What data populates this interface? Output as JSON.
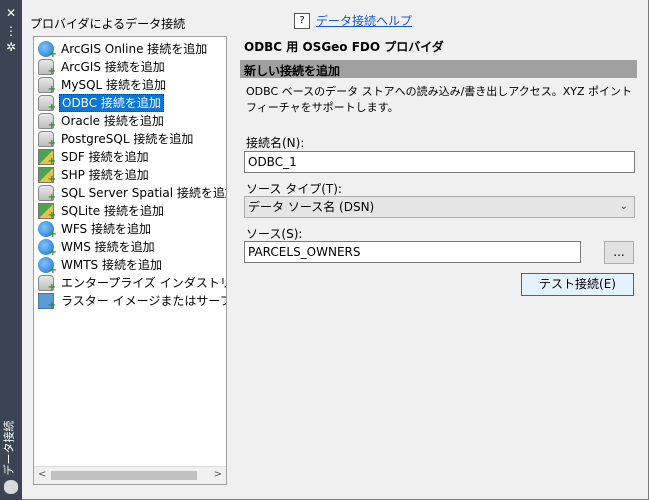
{
  "sidebar": {
    "close_icon": "✕",
    "menu_icon": "⋮",
    "gear_icon": "✲",
    "vertical_title": "データ接続"
  },
  "provider_label": "プロバイダによるデータ接続",
  "help": {
    "icon": "?",
    "link": "データ接続ヘルプ"
  },
  "providers": [
    {
      "label": "ArcGIS Online 接続を追加",
      "icon": "globe"
    },
    {
      "label": "ArcGIS 接続を追加",
      "icon": "db"
    },
    {
      "label": "MySQL 接続を追加",
      "icon": "db"
    },
    {
      "label": "ODBC 接続を追加",
      "icon": "db",
      "selected": true
    },
    {
      "label": "Oracle 接続を追加",
      "icon": "db"
    },
    {
      "label": "PostgreSQL 接続を追加",
      "icon": "db"
    },
    {
      "label": "SDF 接続を追加",
      "icon": "shape"
    },
    {
      "label": "SHP 接続を追加",
      "icon": "shape"
    },
    {
      "label": "SQL Server Spatial 接続を追加",
      "icon": "db"
    },
    {
      "label": "SQLite 接続を追加",
      "icon": "shape"
    },
    {
      "label": "WFS 接続を追加",
      "icon": "globe"
    },
    {
      "label": "WMS 接続を追加",
      "icon": "globe"
    },
    {
      "label": "WMTS 接続を追加",
      "icon": "globe"
    },
    {
      "label": "エンタープライズ インダストリ モデル 接",
      "icon": "db"
    },
    {
      "label": "ラスター イメージまたはサーフェス 接続",
      "icon": "raster"
    }
  ],
  "panel": {
    "title": "ODBC 用 OSGeo FDO プロバイダ",
    "section": "新しい接続を追加",
    "description": "ODBC ベースのデータ ストアへの読み込み/書き出しアクセス。XYZ ポイント フィーチャをサポートします。",
    "conn_name_label": "接続名(N):",
    "conn_name_value": "ODBC_1",
    "source_type_label": "ソース タイプ(T):",
    "source_type_value": "データ ソース名 (DSN)",
    "source_label": "ソース(S):",
    "source_value": "PARCELS_OWNERS",
    "browse_label": "...",
    "test_button": "テスト接続(E)"
  }
}
